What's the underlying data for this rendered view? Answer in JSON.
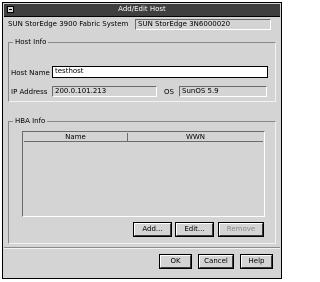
{
  "window": {
    "title": "Add/Edit Host"
  },
  "fabric": {
    "label": "SUN StorEdge 3900 Fabric System",
    "value": "SUN StorEdge 3N6000020"
  },
  "host_info": {
    "group_title": "Host Info",
    "host_name_label": "Host Name",
    "host_name_value": "testhost",
    "ip_address_label": "IP Address",
    "ip_address_value": "200.0.101.213",
    "os_label": "OS",
    "os_value": "SunOS 5.9"
  },
  "hba_info": {
    "group_title": "HBA Info",
    "columns": [
      "Name",
      "WWN"
    ]
  },
  "buttons": {
    "add": "Add...",
    "edit": "Edit...",
    "remove": "Remove",
    "ok": "OK",
    "cancel": "Cancel",
    "help": "Help"
  }
}
